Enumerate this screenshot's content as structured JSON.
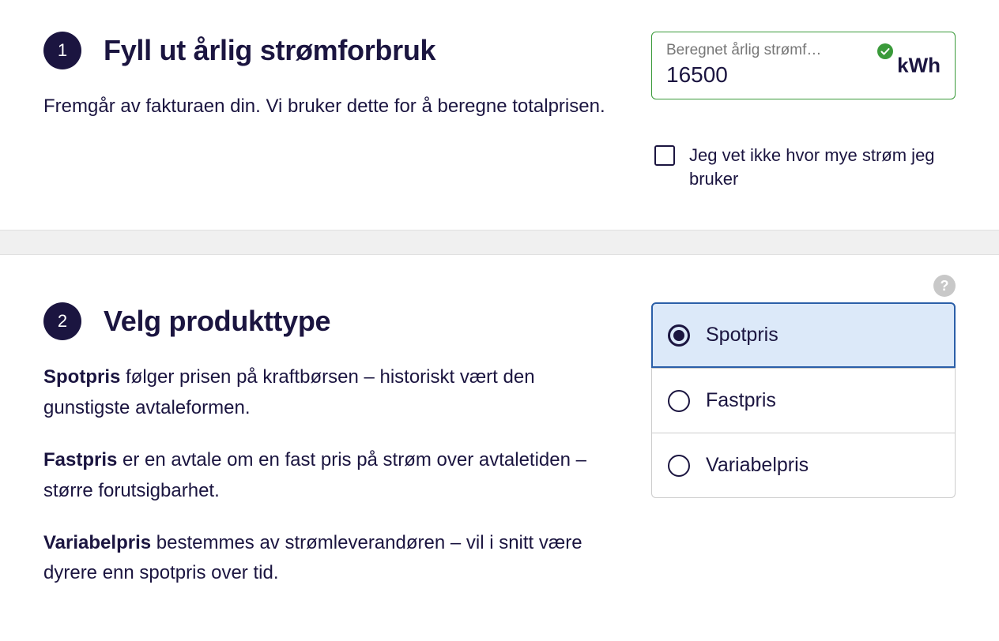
{
  "step1": {
    "number": "1",
    "title": "Fyll ut årlig strømforbruk",
    "description": "Fremgår av fakturaen din. Vi bruker dette for å beregne totalprisen.",
    "input": {
      "label": "Beregnet årlig strømf…",
      "value": "16500",
      "unit": "kWh"
    },
    "checkbox": {
      "label": "Jeg vet ikke hvor mye strøm jeg bruker"
    }
  },
  "step2": {
    "number": "2",
    "title": "Velg produkttype",
    "paragraphs": [
      {
        "strong": "Spotpris",
        "rest": " følger prisen på kraftbørsen – historiskt vært den gunstigste avtaleformen."
      },
      {
        "strong": "Fastpris",
        "rest": " er en avtale om en fast pris på strøm over avtaletiden – større forutsigbarhet."
      },
      {
        "strong": "Variabelpris",
        "rest": " bestemmes av strømleverandøren – vil i snitt være dyrere enn spotpris over tid."
      }
    ],
    "options": [
      {
        "label": "Spotpris",
        "selected": true
      },
      {
        "label": "Fastpris",
        "selected": false
      },
      {
        "label": "Variabelpris",
        "selected": false
      }
    ]
  }
}
